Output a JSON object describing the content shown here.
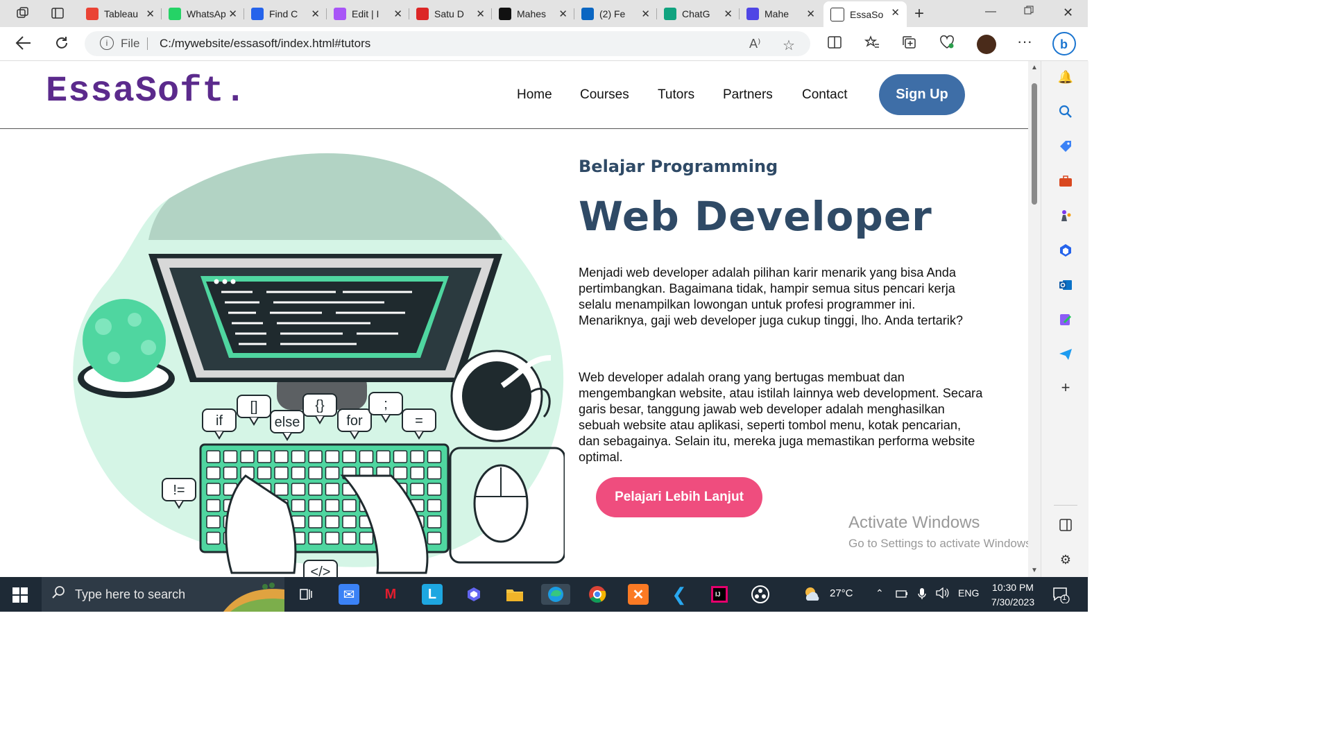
{
  "browser": {
    "tabs": [
      {
        "title": "Tableau",
        "favicon": "gmail-icon",
        "color": "#ea4335"
      },
      {
        "title": "WhatsApp",
        "favicon": "whatsapp-icon",
        "color": "#25d366"
      },
      {
        "title": "Find C",
        "favicon": "k-icon",
        "color": "#2563eb"
      },
      {
        "title": "Edit | I",
        "favicon": "sparkle-icon",
        "color": "#a855f7"
      },
      {
        "title": "Satu D",
        "favicon": "red-diamond-icon",
        "color": "#dc2626"
      },
      {
        "title": "Mahes",
        "favicon": "github-icon",
        "color": "#111111"
      },
      {
        "title": "(2) Fe",
        "favicon": "linkedin-icon",
        "color": "#0a66c2"
      },
      {
        "title": "ChatG",
        "favicon": "chatgpt-icon",
        "color": "#10a37f"
      },
      {
        "title": "Mahe",
        "favicon": "hex-icon",
        "color": "#4f46e5"
      },
      {
        "title": "EssaSo",
        "favicon": "page-icon",
        "color": "#ffffff"
      }
    ],
    "url_prefix": "File",
    "url": "C:/mywebsite/essasoft/index.html#tutors",
    "read_aloud": "A⁾"
  },
  "site": {
    "logo": "EssaSoft.",
    "nav": [
      "Home",
      "Courses",
      "Tutors",
      "Partners",
      "Contact"
    ],
    "signup": "Sign Up",
    "subtitle": "Belajar Programming",
    "title": "Web Developer",
    "paragraph1": "Menjadi web developer adalah pilihan karir menarik yang bisa Anda pertimbangkan. Bagaimana tidak, hampir semua situs pencari kerja selalu menampilkan lowongan untuk profesi programmer ini. Menariknya, gaji web developer juga cukup tinggi, lho. Anda tertarik?",
    "paragraph2": "Web developer adalah orang yang bertugas membuat dan mengembangkan website, atau istilah lainnya web development. Secara garis besar, tanggung jawab web developer adalah menghasilkan sebuah website atau aplikasi, seperti tombol menu, kotak pencarian, dan sebagainya. Selain itu, mereka juga memastikan performa website optimal.",
    "cta": "Pelajari Lebih Lanjut",
    "bubbles": [
      "if",
      "[]",
      "else",
      "{}",
      "for",
      ";",
      "=",
      "!=",
      "</>"
    ],
    "colors": {
      "logo": "#5b2a8c",
      "heading": "#2f4a66",
      "signup": "#3e6ea7",
      "cta": "#ef4d7e",
      "accent": "#4fd6a0"
    }
  },
  "os": {
    "watermark_title": "Activate Windows",
    "watermark_sub": "Go to Settings to activate Windows.",
    "search_placeholder": "Type here to search",
    "weather": "27°C",
    "language": "ENG",
    "time": "10:30 PM",
    "date": "7/30/2023",
    "notification_count": "1"
  }
}
